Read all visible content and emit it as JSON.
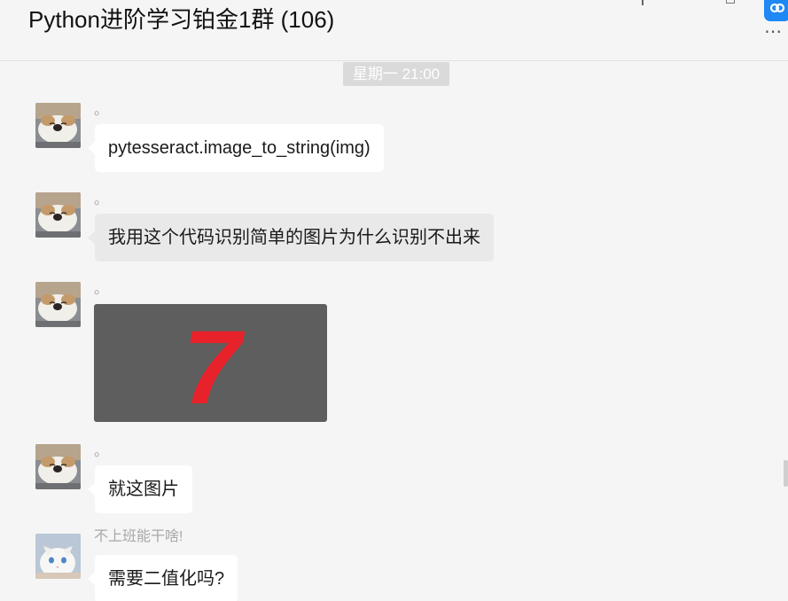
{
  "header": {
    "title": "Python进阶学习铂金1群 (106)",
    "more_glyph": "⋯"
  },
  "chat": {
    "timestamp": "星期一 21:00",
    "messages": [
      {
        "sender": "。",
        "type": "text",
        "text": "pytesseract.image_to_string(img)"
      },
      {
        "sender": "。",
        "type": "text",
        "text": "我用这个代码识别简单的图片为什么识别不出来"
      },
      {
        "sender": "。",
        "type": "image",
        "image_text": "7"
      },
      {
        "sender": "。",
        "type": "text",
        "text": "就这图片"
      },
      {
        "sender": "不上班能干啥!",
        "type": "text",
        "text": "需要二值化吗?"
      }
    ]
  },
  "colors": {
    "accent": "#1e88f5",
    "image_digit": "#e8222a",
    "image_bg": "#5e5e5e"
  }
}
